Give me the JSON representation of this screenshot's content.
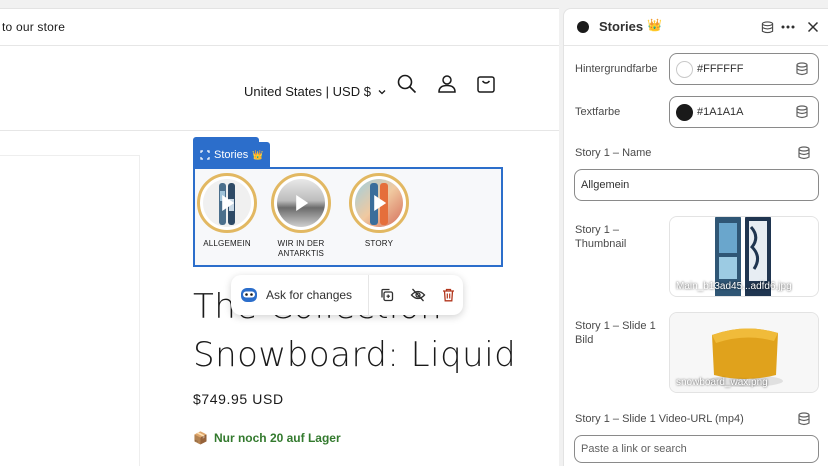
{
  "preview": {
    "announcement": "to our store",
    "country": "United States | USD $",
    "block_label": "Stories",
    "block_emoji": "👑",
    "stories": [
      {
        "label": "ALLGEMEIN",
        "thumb": "snowboard"
      },
      {
        "label": "WIR IN DER ANTARKTIS",
        "thumb": "landscape"
      },
      {
        "label": "STORY",
        "thumb": "snowboard-color"
      }
    ],
    "ask_label": "Ask for changes",
    "product_title_line1": "The Collection",
    "product_title_line2": "Snowboard: Liquid",
    "price": "$749.95 USD",
    "stock_emoji": "📦",
    "stock": "Nur noch 20 auf Lager"
  },
  "panel": {
    "title": "Stories",
    "title_emoji": "👑",
    "fields": {
      "bg_label": "Hintergrundfarbe",
      "bg_value": "#FFFFFF",
      "text_label": "Textfarbe",
      "text_value": "#1A1A1A",
      "name_label": "Story 1 – Name",
      "name_value": "Allgemein",
      "thumb_label": "Story 1 – Thumbnail",
      "thumb_file": "Main_b13ad45...adfd6.jpg",
      "slide_label": "Story 1 – Slide 1 Bild",
      "slide_file": "snowboard_wax.png",
      "video_label": "Story 1 – Slide 1 Video-URL (mp4)",
      "video_placeholder": "Paste a link or search"
    }
  },
  "colors": {
    "accent": "#2c6ecb",
    "ring": "#e2b862",
    "stock": "#337a2e",
    "bg_swatch": "#FFFFFF",
    "text_swatch": "#1A1A1A"
  }
}
